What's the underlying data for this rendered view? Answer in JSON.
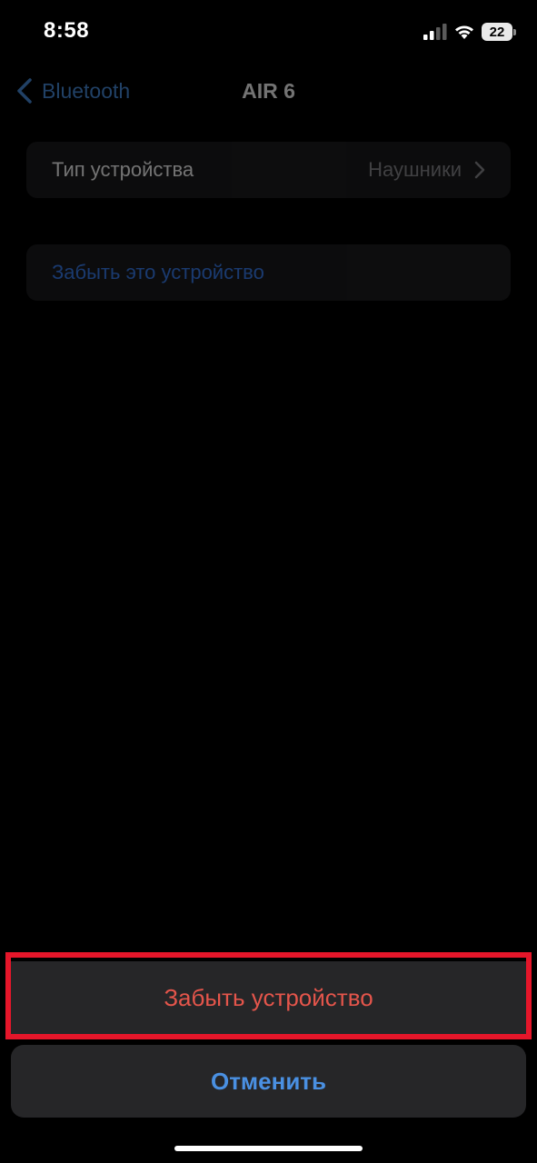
{
  "status_bar": {
    "time": "8:58",
    "battery": "22",
    "icons": [
      "cellular-signal-icon",
      "wifi-icon",
      "battery-icon"
    ]
  },
  "nav": {
    "back_label": "Bluetooth",
    "title": "AIR 6"
  },
  "settings": {
    "device_type_label": "Тип устройства",
    "device_type_value": "Наушники",
    "forget_link": "Забыть это устройство"
  },
  "action_sheet": {
    "forget_button": "Забыть устройство",
    "cancel_button": "Отменить"
  },
  "colors": {
    "destructive": "#e4554b",
    "accent": "#4a90e2",
    "highlight_border": "#e5162a"
  }
}
